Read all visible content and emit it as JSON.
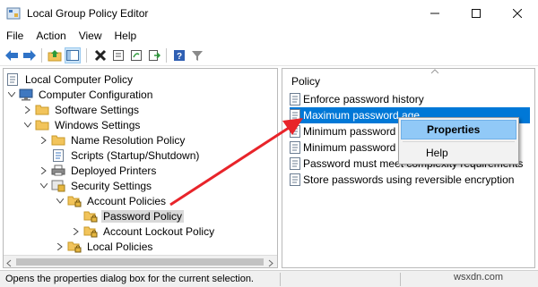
{
  "window": {
    "title": "Local Group Policy Editor"
  },
  "menu": [
    "File",
    "Action",
    "View",
    "Help"
  ],
  "toolbar": {
    "icons": [
      "back-arrow-icon",
      "forward-arrow-icon",
      "up-folder-icon",
      "show-hide-tree-icon",
      "delete-icon",
      "properties-icon",
      "refresh-icon",
      "export-list-icon",
      "help-icon",
      "filter-icon"
    ]
  },
  "tree": {
    "root": "Local Computer Policy",
    "computer_configuration": "Computer Configuration",
    "software_settings": "Software Settings",
    "windows_settings": "Windows Settings",
    "name_resolution_policy": "Name Resolution Policy",
    "scripts": "Scripts (Startup/Shutdown)",
    "deployed_printers": "Deployed Printers",
    "security_settings": "Security Settings",
    "account_policies": "Account Policies",
    "password_policy": "Password Policy",
    "account_lockout_policy": "Account Lockout Policy",
    "local_policies": "Local Policies"
  },
  "policy_list": {
    "header": "Policy",
    "rows": [
      "Enforce password history",
      "Maximum password age",
      "Minimum password",
      "Minimum password",
      "Password must meet complexity requirements",
      "Store passwords using reversible encryption"
    ]
  },
  "context_menu": {
    "properties": "Properties",
    "help": "Help"
  },
  "status": {
    "text": "Opens the properties dialog box for the current selection."
  },
  "watermark": "wsxdn.com",
  "colors": {
    "selection": "#0078d7",
    "context_highlight": "#91c9f7",
    "arrow": "#e8242a",
    "folder": "#f2c45b"
  }
}
